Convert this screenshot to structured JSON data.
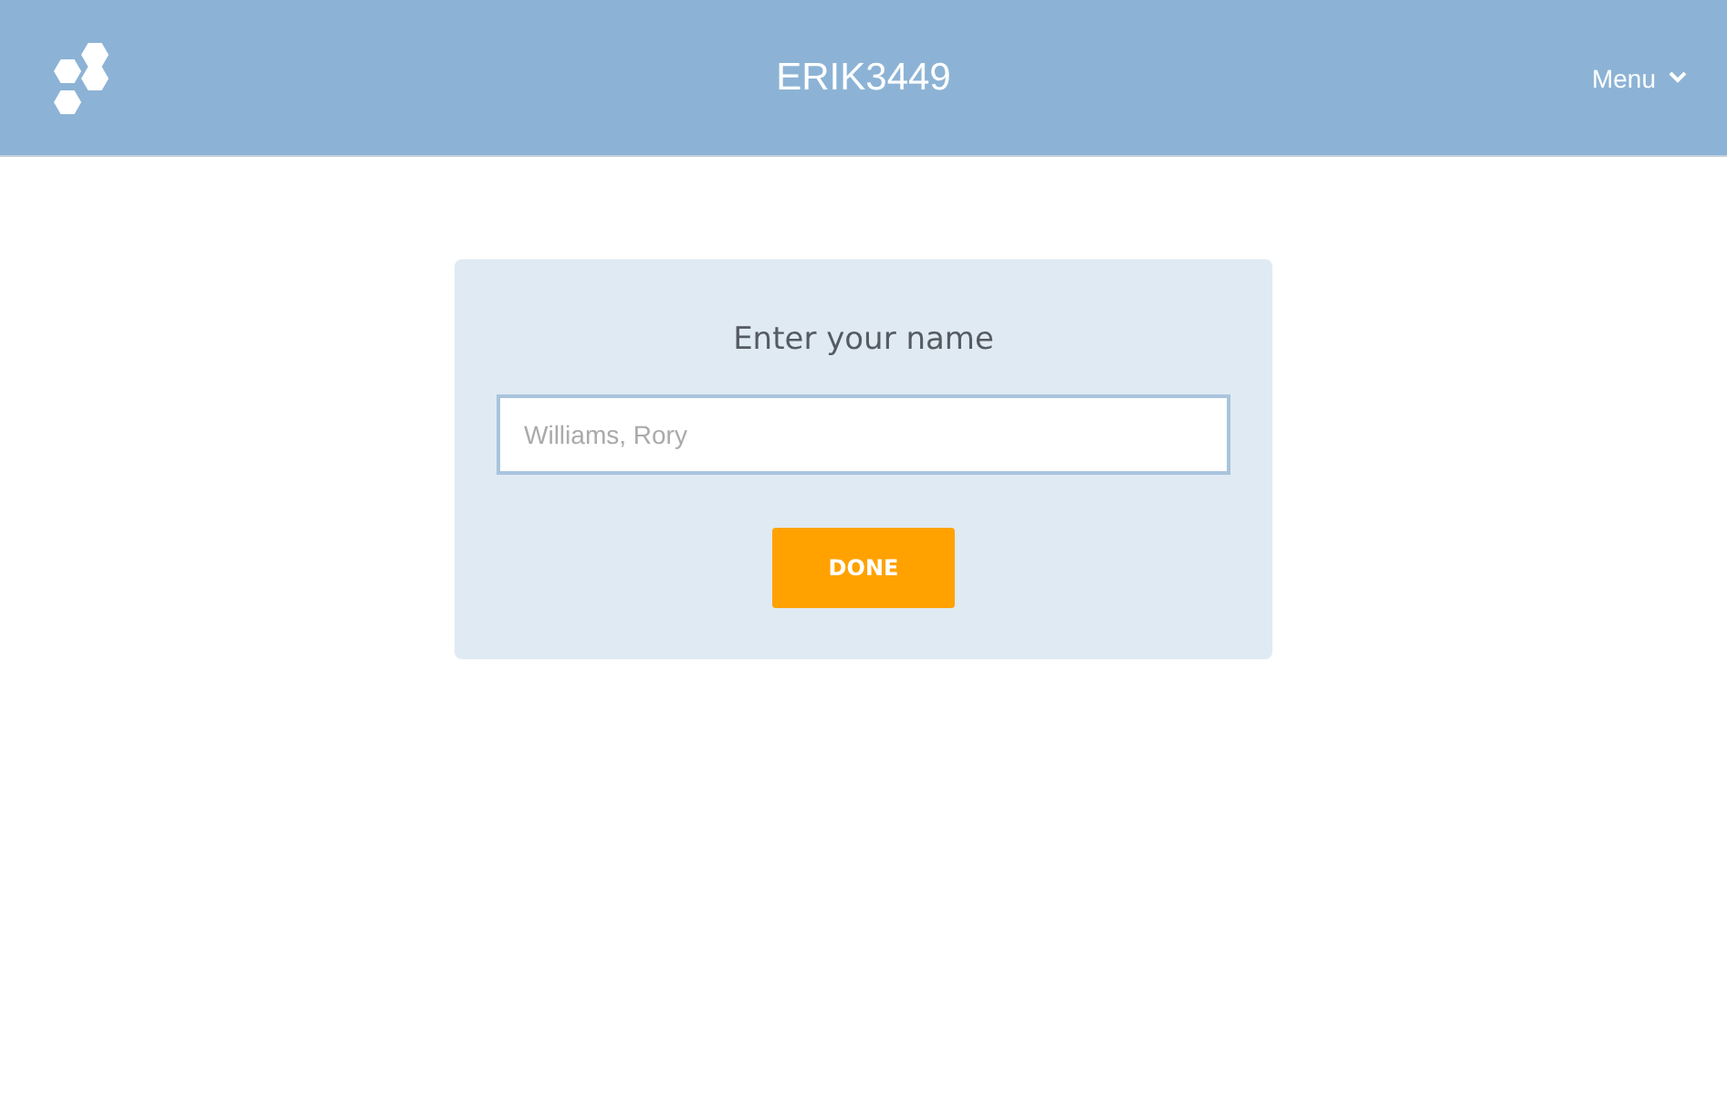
{
  "header": {
    "title": "ERIK3449",
    "menu": "Menu"
  },
  "form": {
    "heading": "Enter your name",
    "name_field": {
      "placeholder": "Williams, Rory"
    },
    "button": "DONE"
  }
}
